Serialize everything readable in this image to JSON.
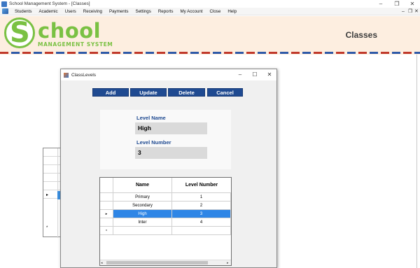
{
  "window": {
    "title": "School Management System - [Classes]",
    "controls": {
      "minimize": "–",
      "maximize": "❐",
      "close": "✕"
    }
  },
  "menubar": {
    "items": [
      "Students",
      "Academic",
      "Users",
      "Receiving",
      "Payments",
      "Settings",
      "Reports",
      "My Account",
      "Close",
      "Help"
    ],
    "mdi_controls": {
      "minimize": "–",
      "restore": "❐",
      "close": "✕"
    }
  },
  "header": {
    "logo_letter": "S",
    "logo_word": "chool",
    "logo_subtitle": "MANAGEMENT SYSTEM",
    "page_title": "Classes",
    "colors": {
      "logo_green": "#7ac143",
      "header_bg": "#fdeee0",
      "stripe_red": "#c0392b",
      "stripe_blue": "#2e5aa8"
    }
  },
  "background_grid": {
    "current_row_marker": "▸",
    "new_row_marker": "*"
  },
  "dialog": {
    "title": "ClassLevels",
    "controls": {
      "minimize": "–",
      "maximize": "☐",
      "close": "✕"
    },
    "buttons": {
      "add": "Add",
      "update": "Update",
      "delete": "Delete",
      "cancel": "Cancel"
    },
    "button_color": "#1f4a91",
    "form": {
      "level_name_label": "Level Name",
      "level_name_value": "High",
      "level_number_label": "Level Number",
      "level_number_value": "3"
    },
    "grid": {
      "columns": [
        "Name",
        "Level Number"
      ],
      "rows": [
        {
          "name": "Primary",
          "level": "1",
          "selected": false
        },
        {
          "name": "Secondary",
          "level": "2",
          "selected": false
        },
        {
          "name": "High",
          "level": "3",
          "selected": true
        },
        {
          "name": "Inter",
          "level": "4",
          "selected": false
        }
      ],
      "current_row_marker": "▸",
      "new_row_marker": "*",
      "selection_color": "#2f86e6",
      "scroll_left": "◂",
      "scroll_right": "▸"
    }
  }
}
